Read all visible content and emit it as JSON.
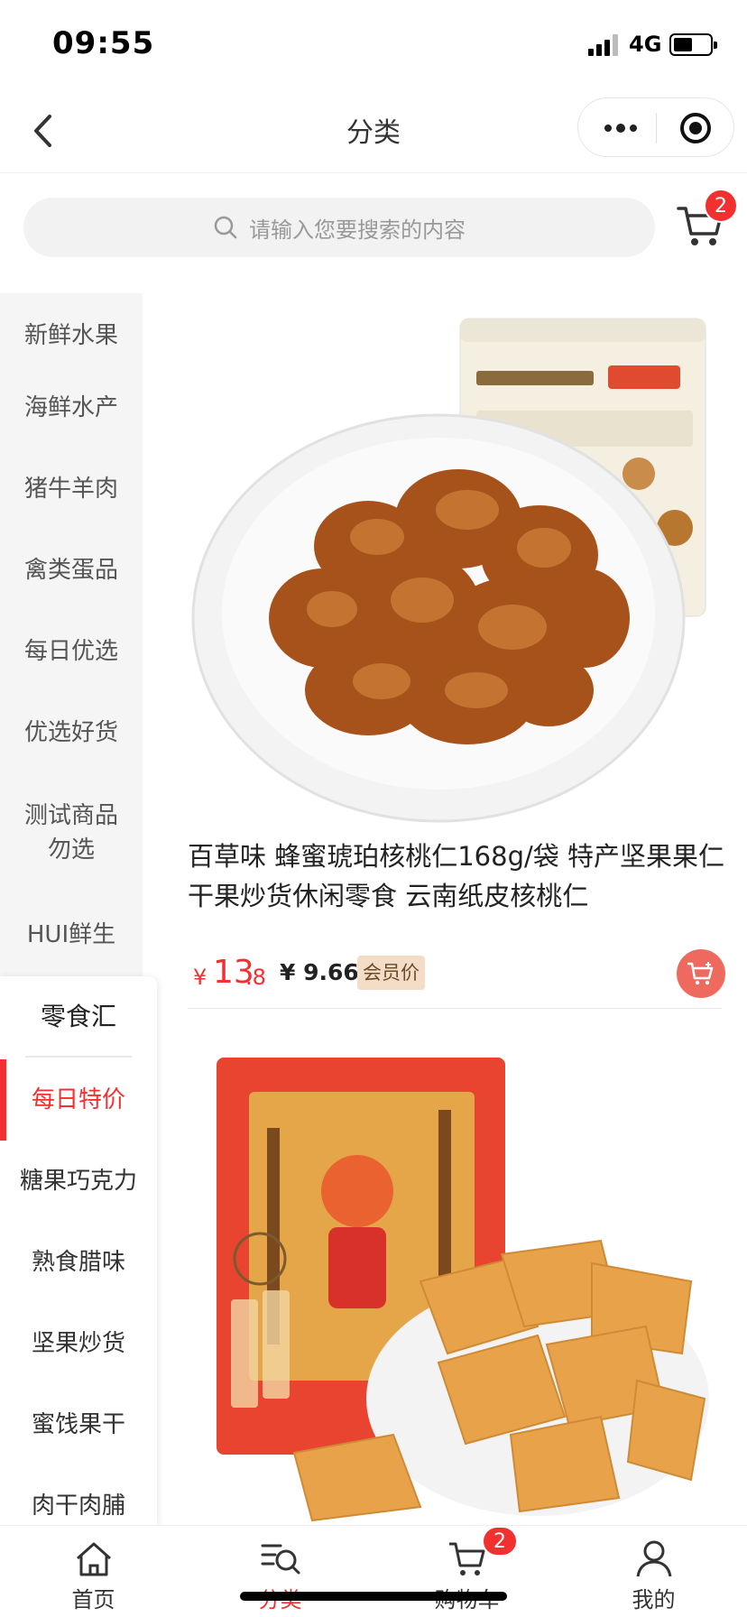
{
  "status_bar": {
    "time": "09:55",
    "network": "4G"
  },
  "nav": {
    "title": "分类"
  },
  "search": {
    "placeholder": "请输入您要搜索的内容",
    "cart_count": "2"
  },
  "sidebar": {
    "items": [
      "新鲜水果",
      "海鲜水产",
      "猪牛羊肉",
      "禽类蛋品",
      "每日优选",
      "优选好货",
      "测试商品勿选",
      "HUI鲜生"
    ],
    "group_title": "零食汇",
    "sub_items": [
      "每日特价",
      "糖果巧克力",
      "熟食腊味",
      "坚果炒货",
      "蜜饯果干",
      "肉干肉脯"
    ],
    "active_sub": "每日特价"
  },
  "products": [
    {
      "title": "百草味 蜂蜜琥珀核桃仁168g/袋 特产坚果果仁 干果炒货休闲零食 云南纸皮核桃仁",
      "currency": "¥",
      "price_int": "13",
      "price_dec": ".8",
      "vip_price": "¥ 9.66",
      "vip_label": "会员价",
      "image_icon": "walnut-product-image"
    },
    {
      "image_icon": "tofu-snack-product-image"
    }
  ],
  "tabs": [
    {
      "label": "首页",
      "icon": "home-icon"
    },
    {
      "label": "分类",
      "icon": "category-icon",
      "active": true
    },
    {
      "label": "购物车",
      "icon": "cart-icon",
      "badge": "2"
    },
    {
      "label": "我的",
      "icon": "user-icon"
    }
  ],
  "colors": {
    "accent": "#f23030",
    "vip_tag": "#f4ddc6",
    "sidebar_bg": "#f5f5f5"
  }
}
